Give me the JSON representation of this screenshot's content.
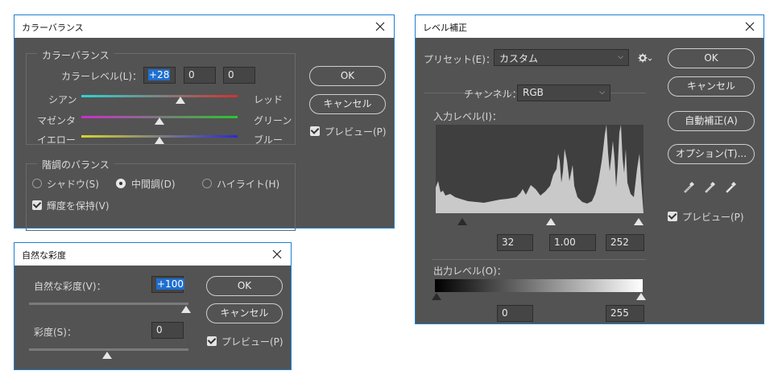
{
  "color_balance": {
    "title": "カラーバランス",
    "group_title": "カラーバランス",
    "level_label": "カラーレベル(L)：",
    "levels": [
      "+28",
      "0",
      "0"
    ],
    "sliders": [
      {
        "left": "シアン",
        "right": "レッド",
        "value": 28
      },
      {
        "left": "マゼンタ",
        "right": "グリーン",
        "value": 0
      },
      {
        "left": "イエロー",
        "right": "ブルー",
        "value": 0
      }
    ],
    "tone_group_title": "階調のバランス",
    "tones": [
      "シャドウ(S)",
      "中間調(D)",
      "ハイライト(H)"
    ],
    "selected_tone": "中間調(D)",
    "preserve_label": "輝度を保持(V)",
    "ok": "OK",
    "cancel": "キャンセル",
    "preview": "プレビュー(P)"
  },
  "vibrance": {
    "title": "自然な彩度",
    "vibrance_label": "自然な彩度(V)：",
    "vibrance_value": "+100",
    "saturation_label": "彩度(S)：",
    "saturation_value": "0",
    "ok": "OK",
    "cancel": "キャンセル",
    "preview": "プレビュー(P)"
  },
  "levels": {
    "title": "レベル補正",
    "preset_label": "プリセット(E)：",
    "preset_value": "カスタム",
    "channel_label": "チャンネル：",
    "channel_value": "RGB",
    "input_label": "入力レベル(I)：",
    "input_values": [
      "32",
      "1.00",
      "252"
    ],
    "output_label": "出力レベル(O)：",
    "output_values": [
      "0",
      "255"
    ],
    "ok": "OK",
    "cancel": "キャンセル",
    "auto": "自動補正(A)",
    "options": "オプション(T)...",
    "preview": "プレビュー(P)",
    "icons": [
      "gear-icon",
      "black-eyedropper-icon",
      "gray-eyedropper-icon",
      "white-eyedropper-icon",
      "close-icon"
    ]
  }
}
